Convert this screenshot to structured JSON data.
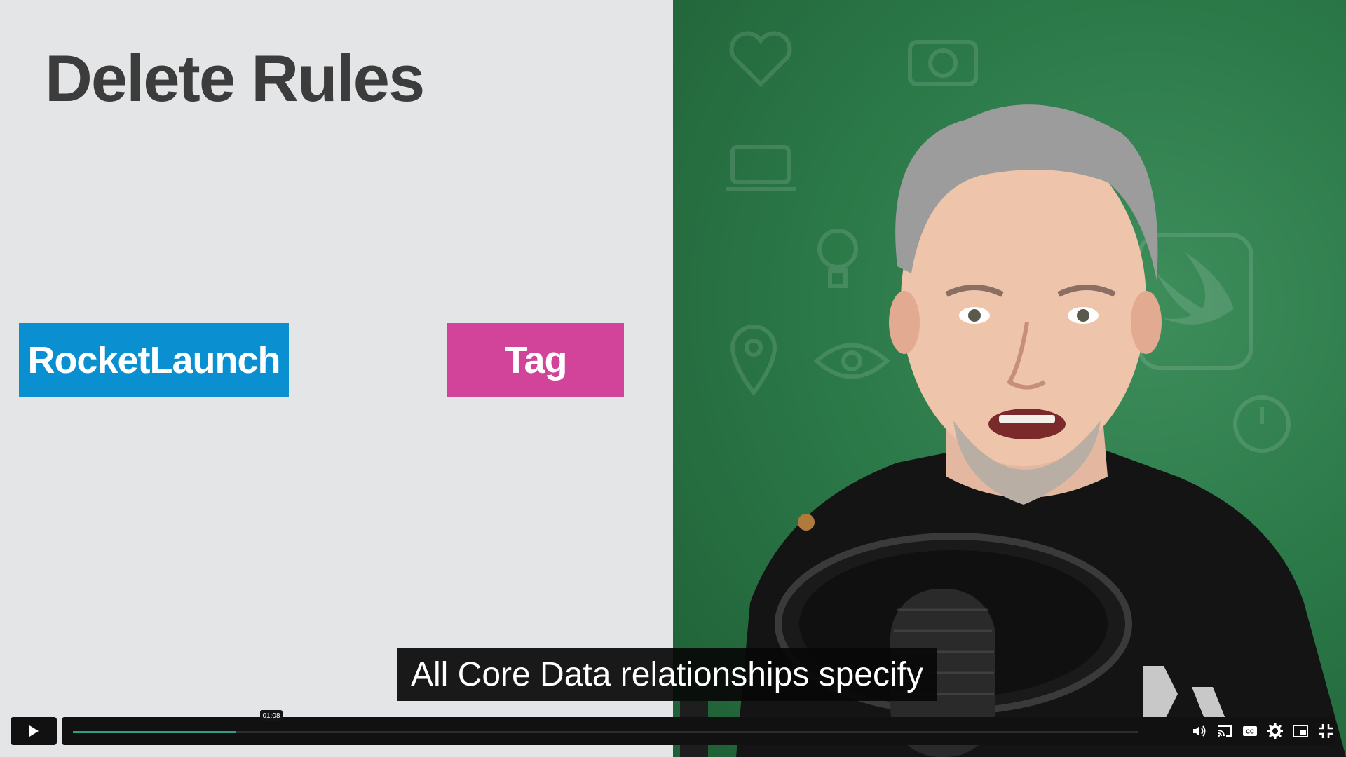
{
  "slide": {
    "title": "Delete Rules",
    "entities": {
      "left": "RocketLaunch",
      "right": "Tag"
    }
  },
  "caption": {
    "text": "All Core Data relationships specify"
  },
  "player": {
    "progress_fraction": 0.153,
    "hover_time": "01:08",
    "icons": [
      "play-icon",
      "volume-icon",
      "cast-icon",
      "cc-icon",
      "settings-icon",
      "pip-icon",
      "exit-fullscreen-icon"
    ],
    "accent": "#2f9e86"
  },
  "colors": {
    "slide_bg": "#e3e5e6",
    "rocketlaunch": "#0a8fd1",
    "tag": "#d1449a",
    "title": "#3c3c3c",
    "green_screen": "#2c7a49"
  }
}
